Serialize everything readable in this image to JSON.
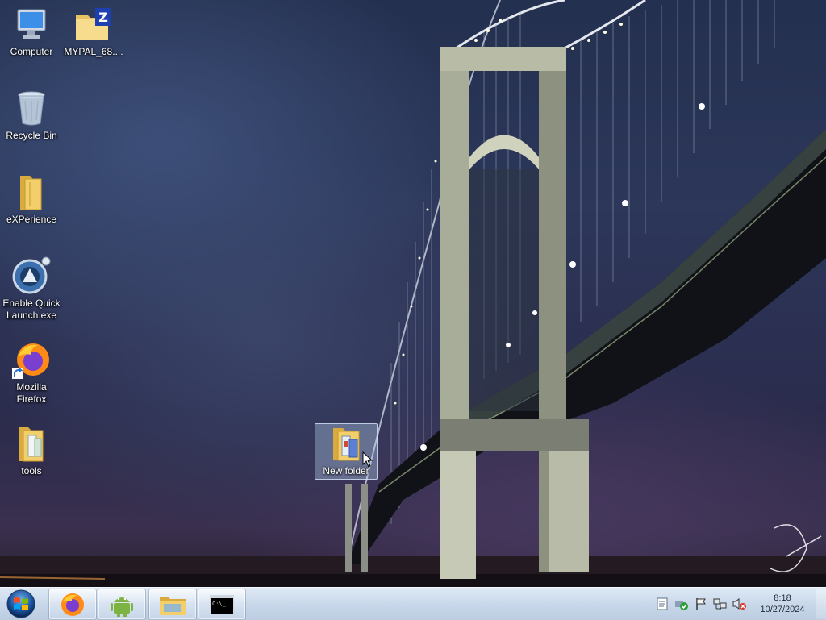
{
  "desktop": {
    "icons": [
      {
        "label": "Computer",
        "icon": "computer-icon"
      },
      {
        "label": "MYPAL_68....",
        "icon": "zip-folder-icon"
      },
      {
        "label": "Recycle Bin",
        "icon": "recycle-bin-icon"
      },
      {
        "label": "eXPerience",
        "icon": "folder-icon"
      },
      {
        "label": "Enable Quick\nLaunch.exe",
        "icon": "quick-launch-app-icon"
      },
      {
        "label": "Mozilla\nFirefox",
        "icon": "firefox-icon"
      },
      {
        "label": "tools",
        "icon": "folder-icon"
      },
      {
        "label": "New folder",
        "icon": "folder-icon",
        "selected": true
      }
    ]
  },
  "taskbar": {
    "start": "start-orb-icon",
    "pinned": [
      "firefox-icon",
      "android-icon",
      "file-explorer-icon",
      "command-prompt-icon"
    ],
    "tray_icons": [
      "notes-icon",
      "security-icon",
      "action-center-flag-icon",
      "network-icon",
      "volume-muted-icon"
    ],
    "clock": {
      "time": "8:18",
      "date": "10/27/2024"
    }
  },
  "colors": {
    "taskbar": "#c9d8ea",
    "selection": "#b4cdeb",
    "folder": "#f2cf6a"
  }
}
